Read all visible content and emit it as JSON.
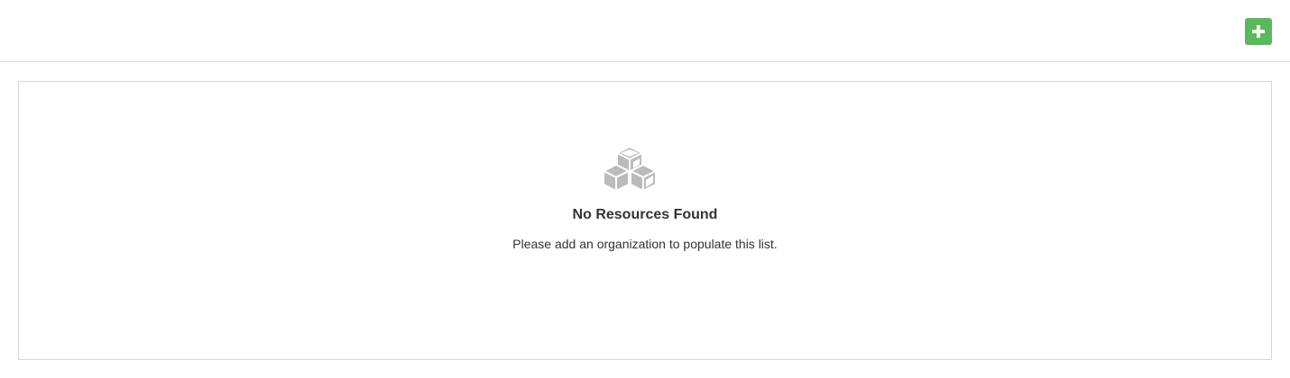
{
  "toolbar": {
    "add_button_icon": "plus-icon",
    "add_button_color": "#5cb85c"
  },
  "empty_state": {
    "icon": "cubes-icon",
    "icon_color": "#bbbbbb",
    "title": "No Resources Found",
    "message": "Please add an organization to populate this list."
  }
}
